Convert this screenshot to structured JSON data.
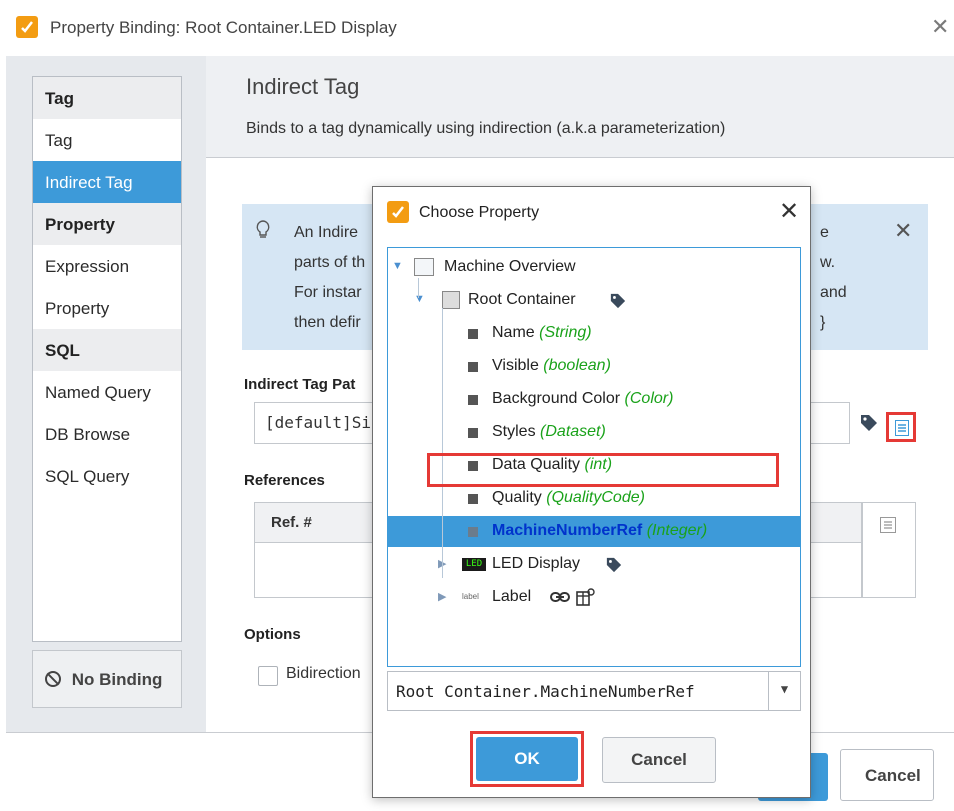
{
  "main_dialog": {
    "title": "Property Binding: Root Container.LED Display",
    "close_glyph": "✕"
  },
  "sidebar": {
    "groups": [
      {
        "header": "Tag",
        "items": [
          "Tag",
          "Indirect Tag"
        ]
      },
      {
        "header": "Property",
        "items": [
          "Expression",
          "Property"
        ]
      },
      {
        "header": "SQL",
        "items": [
          "Named Query",
          "DB Browse",
          "SQL Query"
        ]
      }
    ],
    "selected": "Indirect Tag",
    "no_binding_label": "No Binding",
    "no_binding_icon": "⃠"
  },
  "content": {
    "title": "Indirect Tag",
    "description": "Binds to a tag dynamically using indirection (a.k.a parameterization)",
    "info_lines": [
      "An Indire",
      "parts of th",
      "For instar",
      "then defir"
    ],
    "info_lines_right": [
      "e",
      "w.",
      "and",
      "}"
    ],
    "info_bulb_glyph": "💡",
    "info_close_glyph": "✕",
    "path_label": "Indirect Tag Pat",
    "path_value": "[default]Si",
    "references_label": "References",
    "ref_column": "Ref. #",
    "options_label": "Options",
    "bidirectional_label": "Bidirection"
  },
  "footer": {
    "ok_label": "",
    "cancel_label": "Cancel"
  },
  "modal": {
    "title": "Choose Property",
    "close_glyph": "✕",
    "tree": [
      {
        "label": "Machine Overview",
        "type": ""
      },
      {
        "label": "Root Container",
        "type": ""
      },
      {
        "label": "Name",
        "type": "(String)"
      },
      {
        "label": "Visible",
        "type": "(boolean)"
      },
      {
        "label": "Background Color",
        "type": "(Color)"
      },
      {
        "label": "Styles",
        "type": "(Dataset)"
      },
      {
        "label": "Data Quality",
        "type": "(int)"
      },
      {
        "label": "Quality",
        "type": "(QualityCode)"
      },
      {
        "label": "MachineNumberRef",
        "type": "(Integer)"
      },
      {
        "label": "LED Display",
        "type": ""
      },
      {
        "label": "Label",
        "type": ""
      }
    ],
    "selected_item": "MachineNumberRef",
    "selected_path": "Root Container.MachineNumberRef",
    "ok_label": "OK",
    "cancel_label": "Cancel",
    "led_icon_text": "LED",
    "label_icon_text": "label"
  },
  "colors": {
    "accent": "#3d9ad9",
    "highlight_box": "#e53935",
    "type_green": "#1aa21a",
    "selected_name": "#0033cc",
    "app_icon": "#f39c12"
  }
}
